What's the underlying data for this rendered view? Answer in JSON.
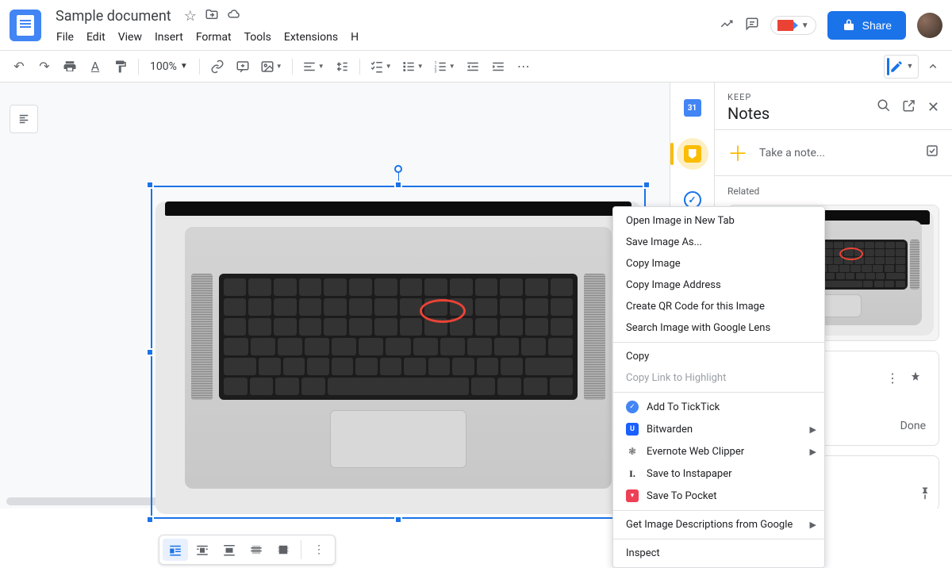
{
  "header": {
    "docTitle": "Sample document",
    "menus": [
      "File",
      "Edit",
      "View",
      "Insert",
      "Format",
      "Tools",
      "Extensions",
      "H"
    ],
    "shareLabel": "Share"
  },
  "toolbar": {
    "zoom": "100%"
  },
  "keep": {
    "smallTitle": "KEEP",
    "title": "Notes",
    "takeNotePlaceholder": "Take a note...",
    "relatedLabel": "Related",
    "doneLabel": "Done"
  },
  "contextMenu": {
    "items": [
      {
        "label": "Open Image in New Tab",
        "type": "item"
      },
      {
        "label": "Save Image As...",
        "type": "item"
      },
      {
        "label": "Copy Image",
        "type": "item"
      },
      {
        "label": "Copy Image Address",
        "type": "item"
      },
      {
        "label": "Create QR Code for this Image",
        "type": "item"
      },
      {
        "label": "Search Image with Google Lens",
        "type": "item"
      },
      {
        "type": "sep"
      },
      {
        "label": "Copy",
        "type": "item"
      },
      {
        "label": "Copy Link to Highlight",
        "type": "disabled"
      },
      {
        "type": "sep"
      },
      {
        "label": "Add To TickTick",
        "type": "ext",
        "icon": "tick"
      },
      {
        "label": "Bitwarden",
        "type": "ext",
        "icon": "bw",
        "arrow": true
      },
      {
        "label": "Evernote Web Clipper",
        "type": "ext",
        "icon": "ev",
        "arrow": true
      },
      {
        "label": "Save to Instapaper",
        "type": "ext",
        "icon": "ip"
      },
      {
        "label": "Save To Pocket",
        "type": "ext",
        "icon": "pk"
      },
      {
        "type": "sep"
      },
      {
        "label": "Get Image Descriptions from Google",
        "type": "item",
        "arrow": true
      },
      {
        "type": "sep"
      },
      {
        "label": "Inspect",
        "type": "item"
      }
    ]
  }
}
